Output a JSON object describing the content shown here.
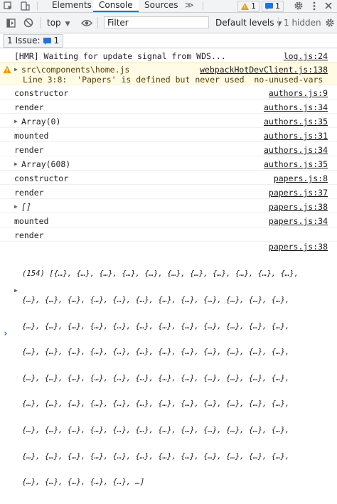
{
  "tabs": {
    "elements": "Elements",
    "console": "Console",
    "sources": "Sources",
    "more": "≫"
  },
  "badges": {
    "warnings": "1",
    "messages": "1"
  },
  "toolbar": {
    "context": "top",
    "filter_placeholder": "Filter",
    "levels": "Default levels",
    "hidden": "1 hidden"
  },
  "issues": {
    "label": "1 Issue:",
    "count": "1"
  },
  "log": [
    {
      "text": "[HMR] Waiting for update signal from WDS...",
      "src": "log.js:24"
    },
    {
      "text": "src\\components\\home.js",
      "src": "webpackHotDevClient.js:138",
      "detail": "Line 3:8:  'Papers' is defined but never used  no-unused-vars"
    },
    {
      "text": "constructor",
      "src": "authors.js:9"
    },
    {
      "text": "render",
      "src": "authors.js:34"
    },
    {
      "text": "Array(0)",
      "src": "authors.js:35"
    },
    {
      "text": "mounted",
      "src": "authors.js:31"
    },
    {
      "text": "render",
      "src": "authors.js:34"
    },
    {
      "text": "Array(608)",
      "src": "authors.js:35"
    },
    {
      "text": "constructor",
      "src": "papers.js:8"
    },
    {
      "text": "render",
      "src": "papers.js:37"
    },
    {
      "text": "[]",
      "src": "papers.js:38"
    },
    {
      "text": "mounted",
      "src": "papers.js:34"
    },
    {
      "text": "render",
      "src": "papers.js:37"
    },
    {
      "text": "",
      "src": "papers.js:38"
    }
  ],
  "array_preview": {
    "lines": [
      "(154) [{…}, {…}, {…}, {…}, {…}, {…}, {…}, {…}, {…}, {…}, {…},",
      "{…}, {…}, {…}, {…}, {…}, {…}, {…}, {…}, {…}, {…}, {…}, {…},",
      "{…}, {…}, {…}, {…}, {…}, {…}, {…}, {…}, {…}, {…}, {…}, {…},",
      "{…}, {…}, {…}, {…}, {…}, {…}, {…}, {…}, {…}, {…}, {…}, {…},",
      "{…}, {…}, {…}, {…}, {…}, {…}, {…}, {…}, {…}, {…}, {…}, {…},",
      "{…}, {…}, {…}, {…}, {…}, {…}, {…}, {…}, {…}, {…}, {…}, {…},",
      "{…}, {…}, {…}, {…}, {…}, {…}, {…}, {…}, {…}, {…}, {…}, {…},",
      "{…}, {…}, {…}, {…}, {…}, {…}, {…}, {…}, {…}, {…}, {…}, {…},",
      "{…}, {…}, {…}, {…}, {…}, …]"
    ]
  },
  "prompt": "›",
  "colors": {
    "accent": "#1a73e8",
    "warning_bg": "#fffbe5",
    "warning_text": "#5c3c00"
  }
}
